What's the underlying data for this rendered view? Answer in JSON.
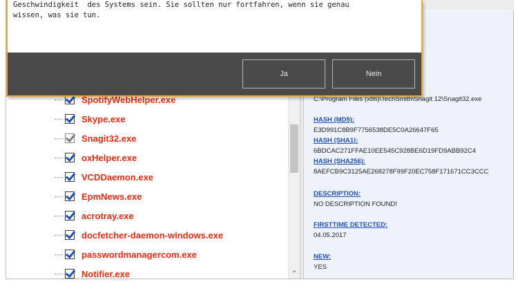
{
  "dialog": {
    "message_line1": "Geschwindigkeit  des Systems sein. Sie sollten nur fortfahren, wenn sie genau",
    "message_line2": "wissen, was sie tun.",
    "yes_label": "Ja",
    "no_label": "Nein"
  },
  "process_list": {
    "items": [
      {
        "label": "SpotifyWebHelper.exe",
        "checked": true
      },
      {
        "label": "Skype.exe",
        "checked": true
      },
      {
        "label": "Snagit32.exe",
        "checked": true
      },
      {
        "label": "oxHelper.exe",
        "checked": true
      },
      {
        "label": "VCDDaemon.exe",
        "checked": true
      },
      {
        "label": "EpmNews.exe",
        "checked": true
      },
      {
        "label": "acrotray.exe",
        "checked": true
      },
      {
        "label": "docfetcher-daemon-windows.exe",
        "checked": true
      },
      {
        "label": "passwordmanagercom.exe",
        "checked": true
      },
      {
        "label": "Notifier.exe",
        "checked": true
      }
    ]
  },
  "details": {
    "path": "C:\\Program Files (x86)\\TechSmith\\Snagit 12\\Snagit32.exe",
    "hash_md5_label": "HASH (MD5):",
    "hash_md5": "E3D991C8B9F7756538DE5C0A26647F65",
    "hash_sha1_label": "HASH (SHA1):",
    "hash_sha1": "6BDCAC271FFAE10EE545C928BE6D19FD9ABB92C4",
    "hash_sha256_label": "HASH (SHA256):",
    "hash_sha256": "8AEFCB9C3125AE268278F99F20EC758F171671CC3CCC",
    "description_label": "DESCRIPTION:",
    "description": "NO DESCRIPTION FOUND!",
    "firsttime_label": "FIRSTTIME DETECTED:",
    "firsttime": "04.05.2017",
    "new_label": "NEW:",
    "new_value": "YES"
  },
  "colors": {
    "dialog_border": "#f0a53a",
    "dialog_footer": "#4a4a4a",
    "process_label": "#e22a10",
    "detail_heading": "#1f4fb4",
    "details_background": "#eef3fb"
  },
  "icons": {
    "scroll_down": "chevron-down-icon",
    "checkbox": "checkbox-icon"
  }
}
